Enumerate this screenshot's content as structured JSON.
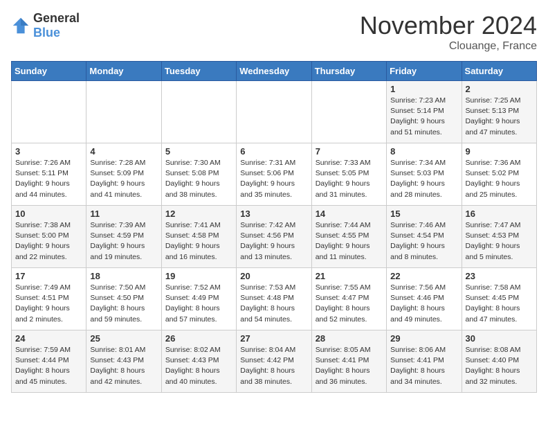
{
  "header": {
    "logo_general": "General",
    "logo_blue": "Blue",
    "title": "November 2024",
    "location": "Clouange, France"
  },
  "weekdays": [
    "Sunday",
    "Monday",
    "Tuesday",
    "Wednesday",
    "Thursday",
    "Friday",
    "Saturday"
  ],
  "weeks": [
    [
      {
        "day": "",
        "info": ""
      },
      {
        "day": "",
        "info": ""
      },
      {
        "day": "",
        "info": ""
      },
      {
        "day": "",
        "info": ""
      },
      {
        "day": "",
        "info": ""
      },
      {
        "day": "1",
        "info": "Sunrise: 7:23 AM\nSunset: 5:14 PM\nDaylight: 9 hours\nand 51 minutes."
      },
      {
        "day": "2",
        "info": "Sunrise: 7:25 AM\nSunset: 5:13 PM\nDaylight: 9 hours\nand 47 minutes."
      }
    ],
    [
      {
        "day": "3",
        "info": "Sunrise: 7:26 AM\nSunset: 5:11 PM\nDaylight: 9 hours\nand 44 minutes."
      },
      {
        "day": "4",
        "info": "Sunrise: 7:28 AM\nSunset: 5:09 PM\nDaylight: 9 hours\nand 41 minutes."
      },
      {
        "day": "5",
        "info": "Sunrise: 7:30 AM\nSunset: 5:08 PM\nDaylight: 9 hours\nand 38 minutes."
      },
      {
        "day": "6",
        "info": "Sunrise: 7:31 AM\nSunset: 5:06 PM\nDaylight: 9 hours\nand 35 minutes."
      },
      {
        "day": "7",
        "info": "Sunrise: 7:33 AM\nSunset: 5:05 PM\nDaylight: 9 hours\nand 31 minutes."
      },
      {
        "day": "8",
        "info": "Sunrise: 7:34 AM\nSunset: 5:03 PM\nDaylight: 9 hours\nand 28 minutes."
      },
      {
        "day": "9",
        "info": "Sunrise: 7:36 AM\nSunset: 5:02 PM\nDaylight: 9 hours\nand 25 minutes."
      }
    ],
    [
      {
        "day": "10",
        "info": "Sunrise: 7:38 AM\nSunset: 5:00 PM\nDaylight: 9 hours\nand 22 minutes."
      },
      {
        "day": "11",
        "info": "Sunrise: 7:39 AM\nSunset: 4:59 PM\nDaylight: 9 hours\nand 19 minutes."
      },
      {
        "day": "12",
        "info": "Sunrise: 7:41 AM\nSunset: 4:58 PM\nDaylight: 9 hours\nand 16 minutes."
      },
      {
        "day": "13",
        "info": "Sunrise: 7:42 AM\nSunset: 4:56 PM\nDaylight: 9 hours\nand 13 minutes."
      },
      {
        "day": "14",
        "info": "Sunrise: 7:44 AM\nSunset: 4:55 PM\nDaylight: 9 hours\nand 11 minutes."
      },
      {
        "day": "15",
        "info": "Sunrise: 7:46 AM\nSunset: 4:54 PM\nDaylight: 9 hours\nand 8 minutes."
      },
      {
        "day": "16",
        "info": "Sunrise: 7:47 AM\nSunset: 4:53 PM\nDaylight: 9 hours\nand 5 minutes."
      }
    ],
    [
      {
        "day": "17",
        "info": "Sunrise: 7:49 AM\nSunset: 4:51 PM\nDaylight: 9 hours\nand 2 minutes."
      },
      {
        "day": "18",
        "info": "Sunrise: 7:50 AM\nSunset: 4:50 PM\nDaylight: 8 hours\nand 59 minutes."
      },
      {
        "day": "19",
        "info": "Sunrise: 7:52 AM\nSunset: 4:49 PM\nDaylight: 8 hours\nand 57 minutes."
      },
      {
        "day": "20",
        "info": "Sunrise: 7:53 AM\nSunset: 4:48 PM\nDaylight: 8 hours\nand 54 minutes."
      },
      {
        "day": "21",
        "info": "Sunrise: 7:55 AM\nSunset: 4:47 PM\nDaylight: 8 hours\nand 52 minutes."
      },
      {
        "day": "22",
        "info": "Sunrise: 7:56 AM\nSunset: 4:46 PM\nDaylight: 8 hours\nand 49 minutes."
      },
      {
        "day": "23",
        "info": "Sunrise: 7:58 AM\nSunset: 4:45 PM\nDaylight: 8 hours\nand 47 minutes."
      }
    ],
    [
      {
        "day": "24",
        "info": "Sunrise: 7:59 AM\nSunset: 4:44 PM\nDaylight: 8 hours\nand 45 minutes."
      },
      {
        "day": "25",
        "info": "Sunrise: 8:01 AM\nSunset: 4:43 PM\nDaylight: 8 hours\nand 42 minutes."
      },
      {
        "day": "26",
        "info": "Sunrise: 8:02 AM\nSunset: 4:43 PM\nDaylight: 8 hours\nand 40 minutes."
      },
      {
        "day": "27",
        "info": "Sunrise: 8:04 AM\nSunset: 4:42 PM\nDaylight: 8 hours\nand 38 minutes."
      },
      {
        "day": "28",
        "info": "Sunrise: 8:05 AM\nSunset: 4:41 PM\nDaylight: 8 hours\nand 36 minutes."
      },
      {
        "day": "29",
        "info": "Sunrise: 8:06 AM\nSunset: 4:41 PM\nDaylight: 8 hours\nand 34 minutes."
      },
      {
        "day": "30",
        "info": "Sunrise: 8:08 AM\nSunset: 4:40 PM\nDaylight: 8 hours\nand 32 minutes."
      }
    ]
  ]
}
